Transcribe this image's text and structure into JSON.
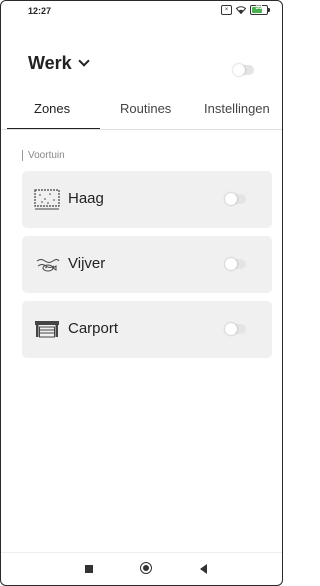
{
  "status_bar": {
    "time": "12:27",
    "battery_level": "33"
  },
  "header": {
    "title": "Werk"
  },
  "tabs": [
    {
      "label": "Zones",
      "active": true
    },
    {
      "label": "Routines",
      "active": false
    },
    {
      "label": "Instellingen",
      "active": false
    }
  ],
  "section": {
    "label": "Voortuin"
  },
  "zones": [
    {
      "name": "Haag",
      "icon": "hedge-icon",
      "enabled": false
    },
    {
      "name": "Vijver",
      "icon": "pond-icon",
      "enabled": false
    },
    {
      "name": "Carport",
      "icon": "carport-icon",
      "enabled": false
    }
  ],
  "colors": {
    "card_bg": "#f0f0f0",
    "toggle_off": "#e4e4e4",
    "text": "#222222",
    "muted": "#888888"
  }
}
